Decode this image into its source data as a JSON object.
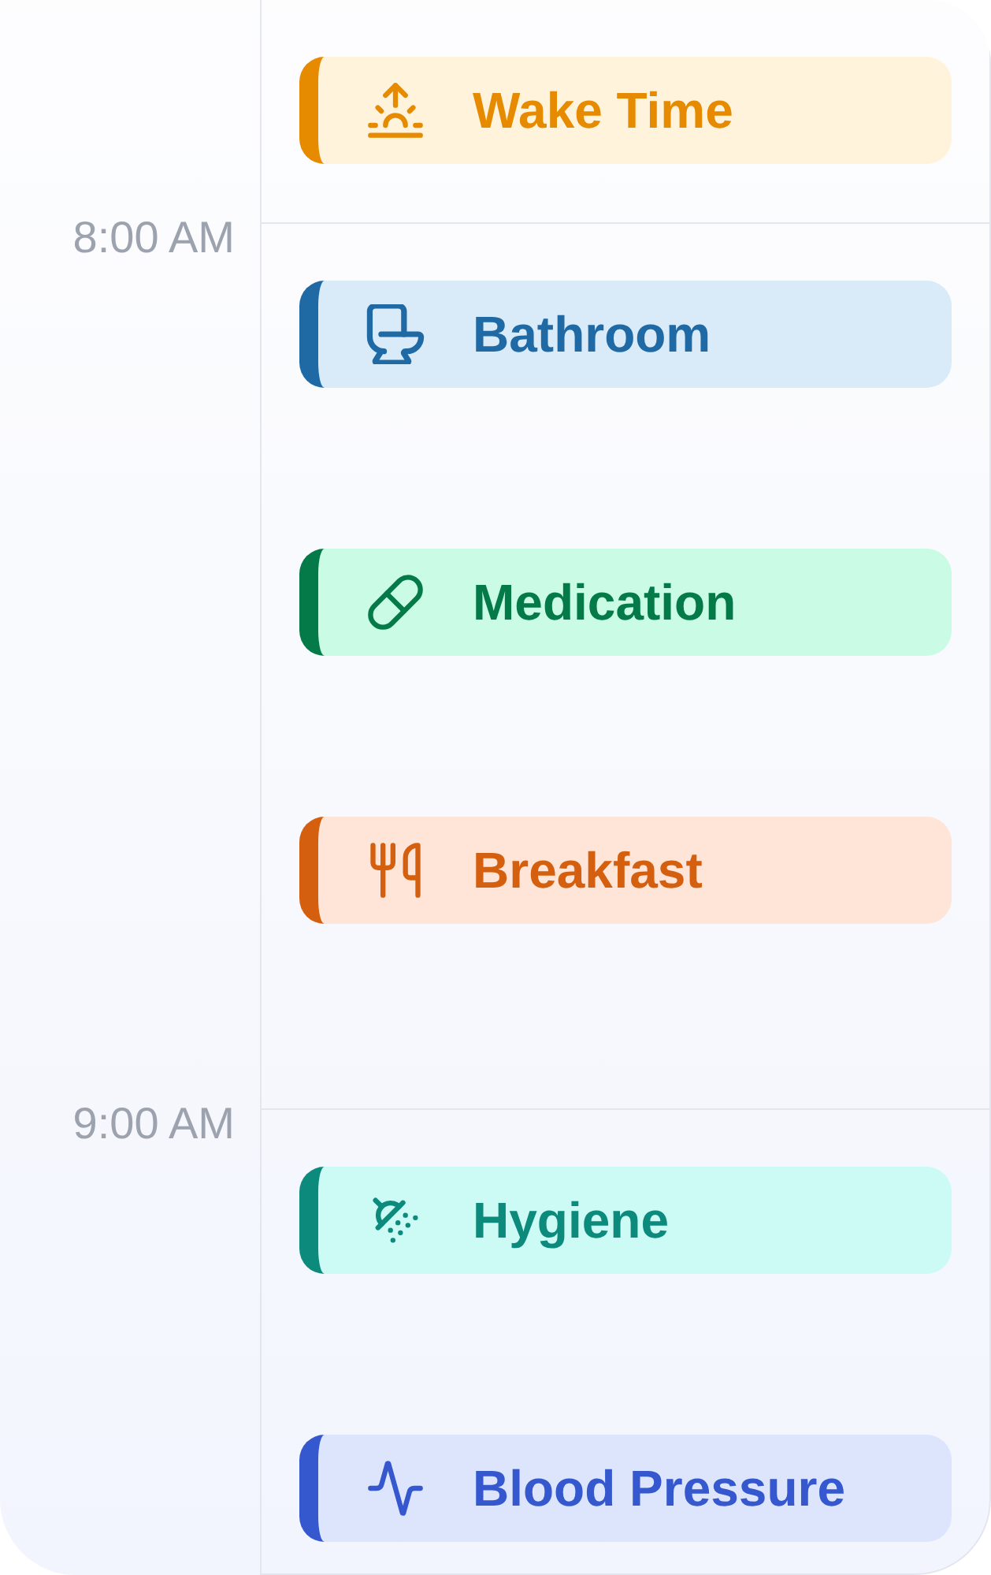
{
  "timeline": {
    "slots": [
      {
        "events": [
          {
            "kind": "wake",
            "title": "Wake Time",
            "color": "#e68a00"
          }
        ]
      },
      {
        "time": "8:00 AM",
        "events": [
          {
            "kind": "bathroom",
            "title": "Bathroom",
            "color": "#1f6aa5"
          },
          {
            "kind": "medication",
            "title": "Medication",
            "color": "#047a48"
          },
          {
            "kind": "meal",
            "title": "Breakfast",
            "color": "#d4600f"
          }
        ]
      },
      {
        "time": "9:00 AM",
        "events": [
          {
            "kind": "hygiene",
            "title": "Hygiene",
            "color": "#0c8a7c"
          },
          {
            "kind": "vitals",
            "title": "Blood Pressure",
            "color": "#3558cf"
          }
        ]
      }
    ]
  }
}
